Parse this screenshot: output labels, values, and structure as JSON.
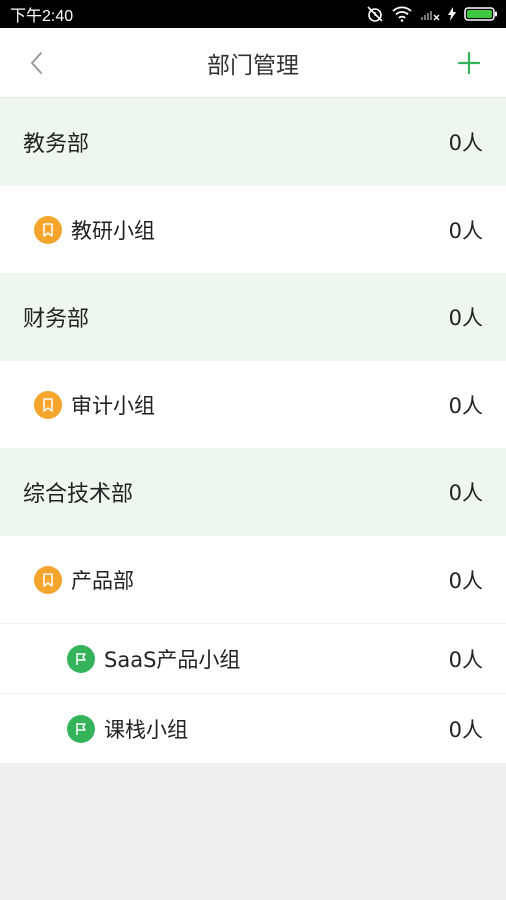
{
  "status_bar": {
    "time": "下午2:40"
  },
  "header": {
    "title": "部门管理"
  },
  "colors": {
    "accent": "#35b35a",
    "group_badge": "#f5a42c",
    "dept_background": "#eef7ee"
  },
  "rows": [
    {
      "type": "department",
      "name": "教务部",
      "count": "0人"
    },
    {
      "type": "group",
      "icon": "bookmark-icon",
      "name": "教研小组",
      "count": "0人"
    },
    {
      "type": "department",
      "name": "财务部",
      "count": "0人"
    },
    {
      "type": "group",
      "icon": "bookmark-icon",
      "name": "审计小组",
      "count": "0人"
    },
    {
      "type": "department",
      "name": "综合技术部",
      "count": "0人"
    },
    {
      "type": "group",
      "icon": "bookmark-icon",
      "name": "产品部",
      "count": "0人"
    },
    {
      "type": "subgroup",
      "icon": "flag-icon",
      "name": "SaaS产品小组",
      "count": "0人"
    },
    {
      "type": "subgroup",
      "icon": "flag-icon",
      "name": "课栈小组",
      "count": "0人"
    }
  ]
}
